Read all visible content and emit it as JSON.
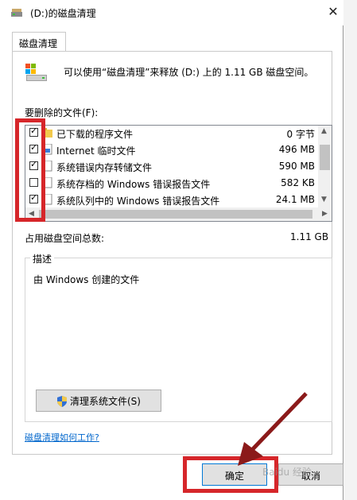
{
  "window": {
    "title": "(D:)的磁盘清理",
    "close_glyph": "✕"
  },
  "tab": {
    "label": "磁盘清理"
  },
  "info": {
    "text": "可以使用“磁盘清理”来释放  (D:) 上的 1.11 GB 磁盘空间。"
  },
  "files": {
    "label": "要删除的文件(F):",
    "items": [
      {
        "name": "已下载的程序文件",
        "size": "0 字节",
        "checked": true,
        "icon": "folder-icon"
      },
      {
        "name": "Internet 临时文件",
        "size": "496 MB",
        "checked": true,
        "icon": "document-lock-icon"
      },
      {
        "name": "系统错误内存转储文件",
        "size": "590 MB",
        "checked": true,
        "icon": "file-icon"
      },
      {
        "name": "系统存档的 Windows 错误报告文件",
        "size": "582 KB",
        "checked": false,
        "icon": "file-icon"
      },
      {
        "name": "系统队列中的 Windows 错误报告文件",
        "size": "24.1 MB",
        "checked": true,
        "icon": "file-icon"
      }
    ]
  },
  "total": {
    "label": "占用磁盘空间总数:",
    "value": "1.11 GB"
  },
  "description": {
    "title": "描述",
    "text": "由 Windows 创建的文件"
  },
  "cleanup_button": {
    "label": "清理系统文件(S)"
  },
  "help_link": {
    "label": "磁盘清理如何工作?"
  },
  "ok_button": {
    "label": "确定"
  },
  "cancel_button": {
    "label": "取消"
  },
  "watermark": {
    "text": "Baidu 经验"
  },
  "colors": {
    "highlight": "#d6262a",
    "link": "#0066cc",
    "accent": "#0078d7"
  }
}
